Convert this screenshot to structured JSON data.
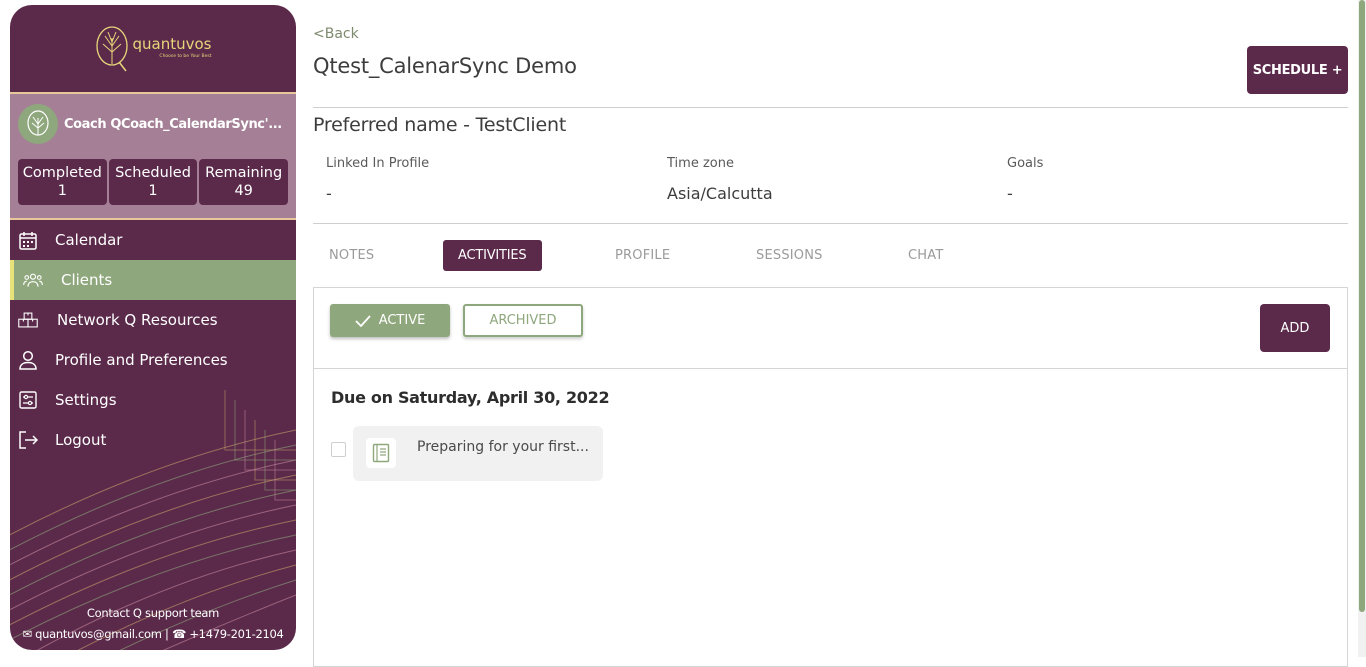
{
  "brand": {
    "name": "quantuvos",
    "tagline": "Choose to be Your Best"
  },
  "coach": {
    "name": "Coach QCoach_CalendarSync'...",
    "stats": [
      {
        "label": "Completed",
        "value": "1"
      },
      {
        "label": "Scheduled",
        "value": "1"
      },
      {
        "label": "Remaining",
        "value": "49"
      }
    ]
  },
  "nav": [
    {
      "label": "Calendar",
      "icon": "calendar-icon"
    },
    {
      "label": "Clients",
      "icon": "users-icon",
      "active": true
    },
    {
      "label": "Network Q Resources",
      "icon": "network-icon"
    },
    {
      "label": "Profile and Preferences",
      "icon": "user-icon"
    },
    {
      "label": "Settings",
      "icon": "settings-icon"
    },
    {
      "label": "Logout",
      "icon": "logout-icon"
    }
  ],
  "support": {
    "title": "Contact Q support team",
    "email": "quantuvos@gmail.com",
    "phone": "+1479-201-2104"
  },
  "header": {
    "back_label": "<Back",
    "title": "Qtest_CalenarSync Demo",
    "schedule_label": "SCHEDULE +",
    "preferred_name": "Preferred name  - TestClient"
  },
  "info": [
    {
      "label": "Linked In Profile",
      "value": "-"
    },
    {
      "label": "Time zone",
      "value": "Asia/Calcutta"
    },
    {
      "label": "Goals",
      "value": "-"
    }
  ],
  "tabs": [
    {
      "label": "NOTES"
    },
    {
      "label": "ACTIVITIES",
      "active": true
    },
    {
      "label": "PROFILE"
    },
    {
      "label": "SESSIONS"
    },
    {
      "label": "CHAT"
    }
  ],
  "activities": {
    "filters": {
      "active_label": "ACTIVE",
      "archived_label": "ARCHIVED",
      "selected": "ACTIVE"
    },
    "add_label": "ADD",
    "due_heading": "Due on Saturday, April 30, 2022",
    "items": [
      {
        "title": "Preparing for your first...",
        "checked": false
      }
    ]
  },
  "colors": {
    "primary": "#5b2a4a",
    "accent": "#8fa77d",
    "sidebar_mid": "#a47f95",
    "highlight": "#e7e27a"
  }
}
